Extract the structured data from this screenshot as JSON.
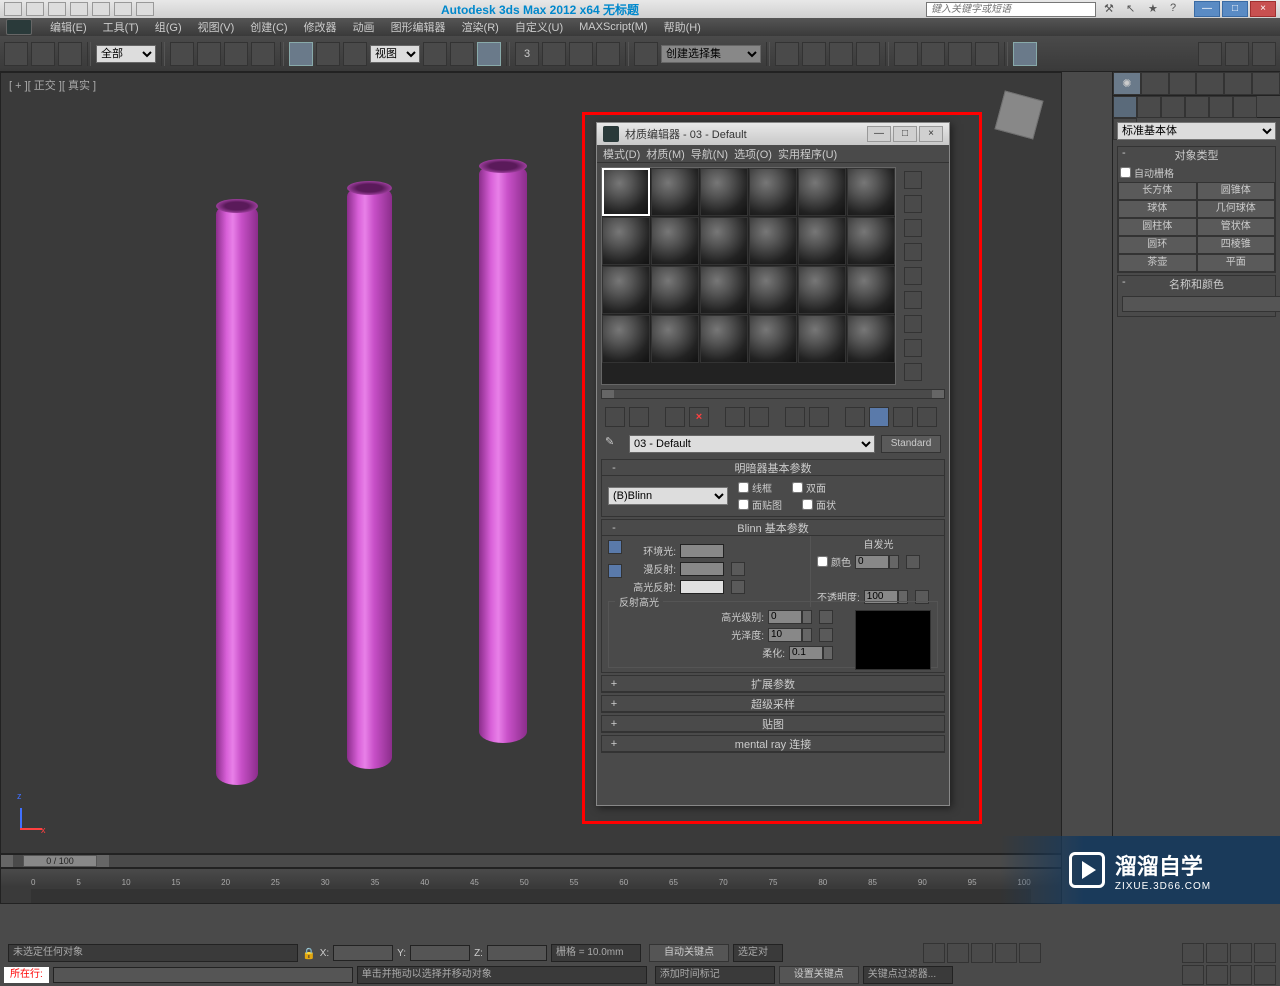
{
  "titlebar": {
    "title": "Autodesk 3ds Max  2012 x64   无标题",
    "search_placeholder": "键入关键字或短语",
    "min": "—",
    "max": "□",
    "close": "×"
  },
  "menu": {
    "edit": "编辑(E)",
    "tools": "工具(T)",
    "group": "组(G)",
    "views": "视图(V)",
    "create": "创建(C)",
    "modifiers": "修改器",
    "animation": "动画",
    "graph": "图形编辑器",
    "rendering": "渲染(R)",
    "customize": "自定义(U)",
    "maxscript": "MAXScript(M)",
    "help": "帮助(H)"
  },
  "toolbar": {
    "all_filter": "全部",
    "view_combo": "视图",
    "named_sel": "创建选择集"
  },
  "viewport": {
    "label": "[ + ][ 正交 ][ 真实 ]"
  },
  "mat_editor": {
    "title": "材质编辑器 - 03 - Default",
    "menu": {
      "mode": "模式(D)",
      "material": "材质(M)",
      "navigation": "导航(N)",
      "options": "选项(O)",
      "utilities": "实用程序(U)"
    },
    "name": "03 - Default",
    "type": "Standard",
    "shader_rollout": "明暗器基本参数",
    "shader": "(B)Blinn",
    "wire": "线框",
    "two_sided": "双面",
    "face_map": "面贴图",
    "faceted": "面状",
    "blinn_rollout": "Blinn 基本参数",
    "ambient": "环境光:",
    "diffuse": "漫反射:",
    "specular": "高光反射:",
    "self_illum": "自发光",
    "color_chk": "颜色",
    "self_illum_val": "0",
    "opacity": "不透明度:",
    "opacity_val": "100",
    "spec_highlight": "反射高光",
    "spec_level": "高光级别:",
    "spec_level_val": "0",
    "glossiness": "光泽度:",
    "glossiness_val": "10",
    "soften": "柔化:",
    "soften_val": "0.1",
    "extended": "扩展参数",
    "supersample": "超级采样",
    "maps": "贴图",
    "mental_ray": "mental ray 连接"
  },
  "right_panel": {
    "category": "标准基本体",
    "obj_type": "对象类型",
    "autogrid": "自动栅格",
    "box": "长方体",
    "cone": "圆锥体",
    "sphere": "球体",
    "geosphere": "几何球体",
    "cylinder": "圆柱体",
    "tube": "管状体",
    "torus": "圆环",
    "pyramid": "四棱锥",
    "teapot": "茶壶",
    "plane": "平面",
    "name_color": "名称和颜色"
  },
  "time": {
    "frame": "0 / 100",
    "ticks": [
      "0",
      "5",
      "10",
      "15",
      "20",
      "25",
      "30",
      "35",
      "40",
      "45",
      "50",
      "55",
      "60",
      "65",
      "70",
      "75",
      "80",
      "85",
      "90",
      "95",
      "100"
    ]
  },
  "status": {
    "none_selected": "未选定任何对象",
    "prompt": "单击并拖动以选择并移动对象",
    "x": "X:",
    "y": "Y:",
    "z": "Z:",
    "grid": "栅格 = 10.0mm",
    "autokey": "自动关键点",
    "selected": "选定对",
    "set_key": "设置关键点",
    "key_filter": "关键点过滤器...",
    "add_time_tag": "添加时间标记",
    "script_label": "所在行:"
  },
  "watermark": {
    "big": "溜溜自学",
    "small": "ZIXUE.3D66.COM"
  }
}
